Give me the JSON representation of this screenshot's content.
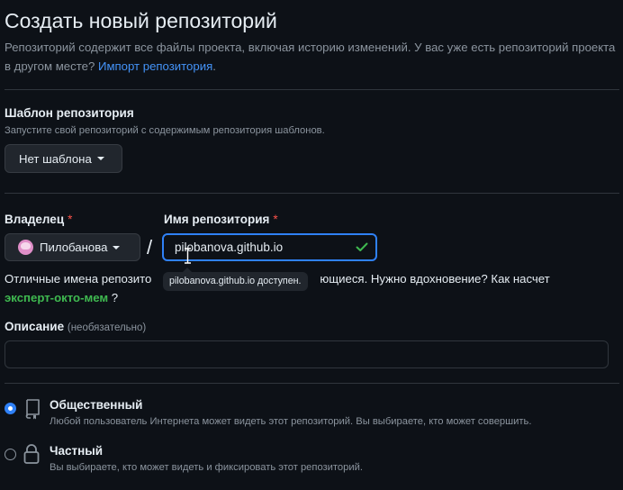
{
  "header": {
    "title": "Создать новый репозиторий",
    "description": "Репозиторий содержит все файлы проекта, включая историю изменений. У вас уже есть репозиторий проекта в другом месте?",
    "import_link": "Импорт репозитория",
    "import_suffix": "."
  },
  "template": {
    "label": "Шаблон репозитория",
    "hint": "Запустите свой репозиторий с содержимым репозитория шаблонов.",
    "button_label": "Нет шаблона"
  },
  "owner": {
    "label": "Владелец",
    "required_mark": "*",
    "selected": "Пилобанова"
  },
  "separator": "/",
  "repo_name": {
    "label": "Имя репозитория",
    "required_mark": "*",
    "value": "pilobanova.github.io",
    "tooltip": "pilobanova.github.io доступен."
  },
  "hint": {
    "text_start": "Отличные имена репозито",
    "text_end": "ющиеся. Нужно вдохновение? Как насчет",
    "suggestion": "эксперт-окто-мем",
    "suffix": " ?"
  },
  "description_field": {
    "label": "Описание",
    "optional": "(необязательно)",
    "value": ""
  },
  "visibility": {
    "public": {
      "title": "Общественный",
      "description": "Любой пользователь Интернета может видеть этот репозиторий. Вы выбираете, кто может совершить.",
      "checked": true
    },
    "private": {
      "title": "Частный",
      "description": "Вы выбираете, кто может видеть и фиксировать этот репозиторий.",
      "checked": false
    }
  },
  "colors": {
    "background": "#0d1117",
    "link": "#4493f8",
    "success": "#3fb950",
    "required": "#f85149",
    "focus": "#2f81f7"
  }
}
